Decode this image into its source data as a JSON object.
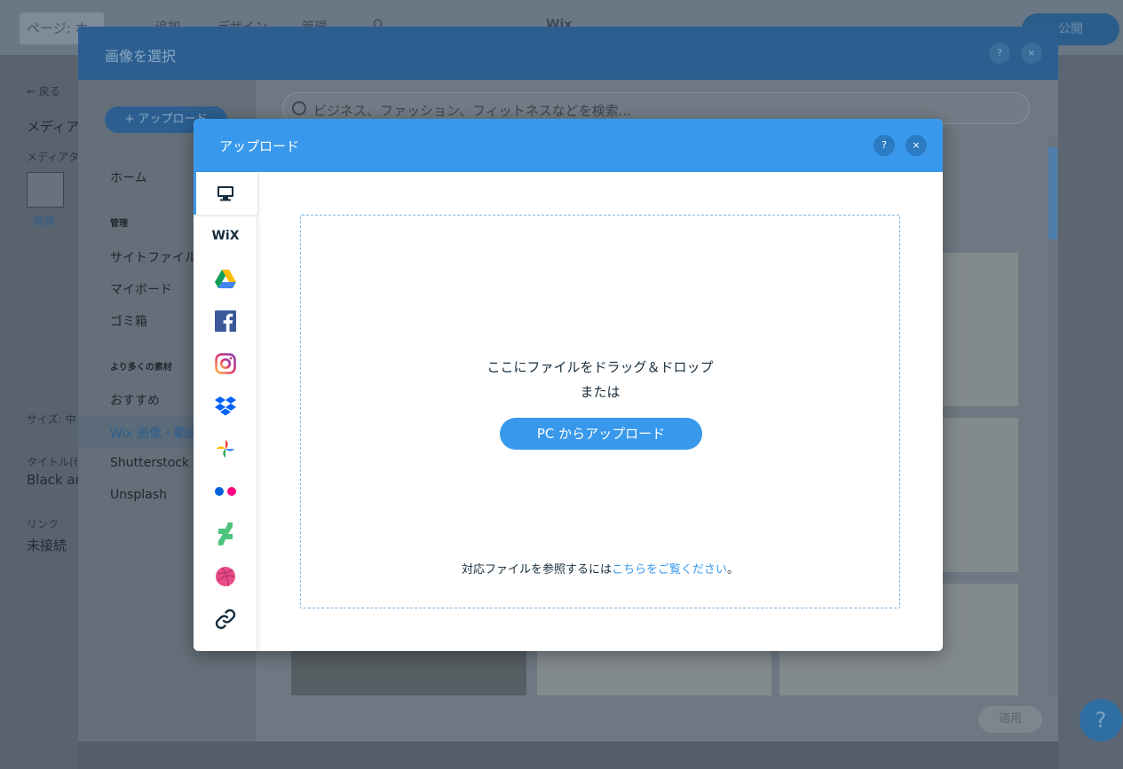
{
  "editor": {
    "pages_label": "ページ: ホ",
    "menu_add": "追加",
    "menu_design": "デザイン",
    "menu_manage": "管理",
    "menu_search": "Q",
    "site_name": "Wix",
    "publish_label": "公開",
    "left": {
      "back": "← 戻る",
      "media_label": "メディアの",
      "media_type": "メディアタイ",
      "image_label": "画像",
      "size": "サイズ: 中",
      "title_label": "タイトル(代",
      "title_value": "Black ar",
      "link_label": "リンク",
      "link_value": "未接続"
    },
    "help": "?"
  },
  "media_dialog": {
    "title": "画像を選択",
    "help": "?",
    "close": "×",
    "upload_button": "+ アップロード",
    "nav": {
      "home": "ホーム",
      "manage_heading": "管理",
      "site_files": "サイトファイル",
      "my_boards": "マイボード",
      "trash": "ゴミ箱",
      "more_heading": "より多くの素材",
      "recommended": "おすすめ",
      "wix_media": "Wix 画像・動画素",
      "shutterstock": "Shutterstock",
      "unsplash": "Unsplash"
    },
    "search_placeholder": "ビジネス、ファッション、フィットネスなどを検索...",
    "apply": "適用"
  },
  "upload_modal": {
    "title": "アップロード",
    "help": "?",
    "close": "×",
    "sources": [
      {
        "icon": "computer-icon",
        "label": "My Computer"
      },
      {
        "icon": "wix-icon",
        "label": "WiX"
      },
      {
        "icon": "google-drive-icon",
        "label": "Google Drive"
      },
      {
        "icon": "facebook-icon",
        "label": "Facebook"
      },
      {
        "icon": "instagram-icon",
        "label": "Instagram"
      },
      {
        "icon": "dropbox-icon",
        "label": "Dropbox"
      },
      {
        "icon": "google-photos-icon",
        "label": "Google Photos"
      },
      {
        "icon": "flickr-icon",
        "label": "Flickr"
      },
      {
        "icon": "deviantart-icon",
        "label": "DeviantArt"
      },
      {
        "icon": "dribbble-icon",
        "label": "Dribbble"
      },
      {
        "icon": "link-icon",
        "label": "URL"
      }
    ],
    "drop_text": "ここにファイルをドラッグ＆ドロップ",
    "or_text": "または",
    "upload_from_pc": "PC からアップロード",
    "supported_prefix": "対応ファイルを参照するには",
    "supported_link": "こちらをご覧ください",
    "supported_suffix": "。"
  },
  "colors": {
    "accent": "#3899ec",
    "text": "#162d3d"
  }
}
